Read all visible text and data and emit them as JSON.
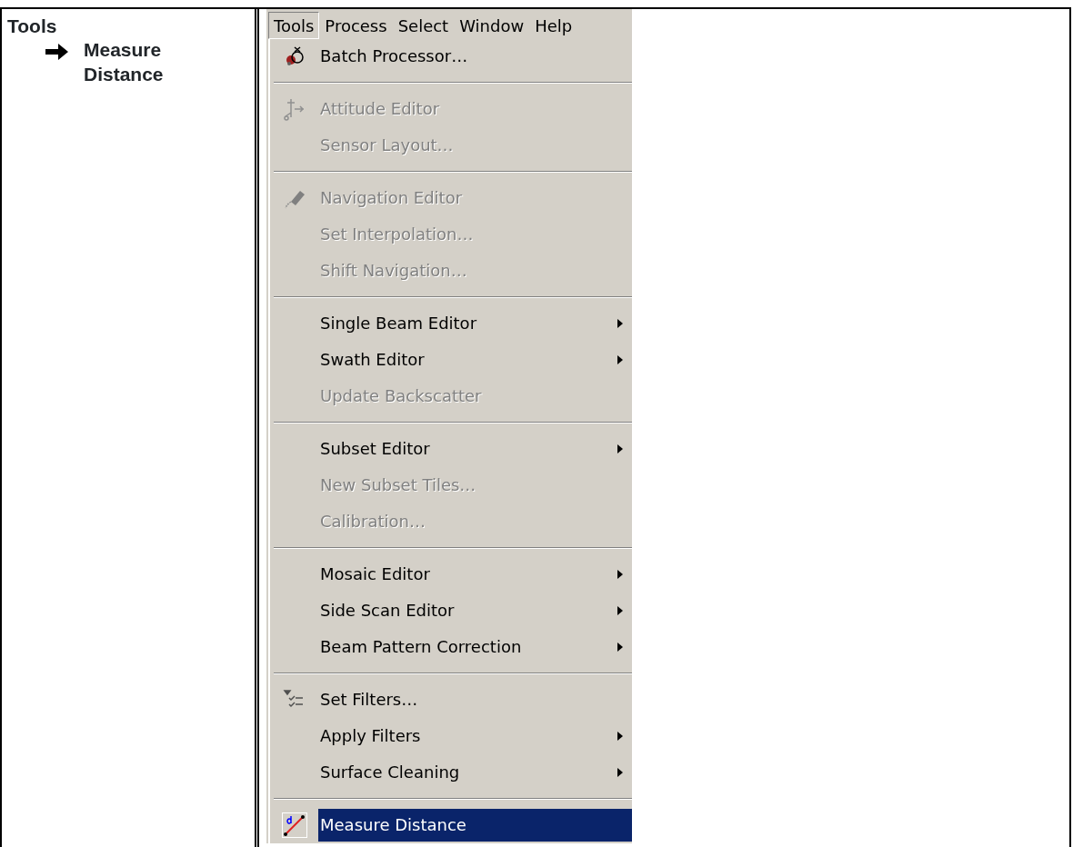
{
  "document_cell": {
    "heading": "Tools",
    "step": "Measure Distance"
  },
  "menubar": [
    {
      "label": "Tools",
      "selected": true
    },
    {
      "label": "Process",
      "selected": false
    },
    {
      "label": "Select",
      "selected": false
    },
    {
      "label": "Window",
      "selected": false
    },
    {
      "label": "Help",
      "selected": false
    }
  ],
  "menu_groups": [
    [
      {
        "label": "Batch Processor…",
        "disabled": false,
        "submenu": false,
        "selected": false
      }
    ],
    [
      {
        "label": "Attitude Editor",
        "disabled": true,
        "submenu": false,
        "selected": false
      },
      {
        "label": "Sensor Layout…",
        "disabled": true,
        "submenu": false,
        "selected": false
      }
    ],
    [
      {
        "label": "Navigation Editor",
        "disabled": true,
        "submenu": false,
        "selected": false
      },
      {
        "label": "Set Interpolation…",
        "disabled": true,
        "submenu": false,
        "selected": false
      },
      {
        "label": "Shift Navigation…",
        "disabled": true,
        "submenu": false,
        "selected": false
      }
    ],
    [
      {
        "label": "Single Beam Editor",
        "disabled": false,
        "submenu": true,
        "selected": false
      },
      {
        "label": "Swath Editor",
        "disabled": false,
        "submenu": true,
        "selected": false
      },
      {
        "label": "Update Backscatter",
        "disabled": true,
        "submenu": false,
        "selected": false
      }
    ],
    [
      {
        "label": "Subset Editor",
        "disabled": false,
        "submenu": true,
        "selected": false
      },
      {
        "label": "New Subset Tiles…",
        "disabled": true,
        "submenu": false,
        "selected": false
      },
      {
        "label": "Calibration…",
        "disabled": true,
        "submenu": false,
        "selected": false
      }
    ],
    [
      {
        "label": "Mosaic Editor",
        "disabled": false,
        "submenu": true,
        "selected": false
      },
      {
        "label": "Side Scan Editor",
        "disabled": false,
        "submenu": true,
        "selected": false
      },
      {
        "label": "Beam Pattern Correction",
        "disabled": false,
        "submenu": true,
        "selected": false
      }
    ],
    [
      {
        "label": "Set Filters…",
        "disabled": false,
        "submenu": false,
        "selected": false
      },
      {
        "label": "Apply Filters",
        "disabled": false,
        "submenu": true,
        "selected": false
      },
      {
        "label": "Surface Cleaning",
        "disabled": false,
        "submenu": true,
        "selected": false
      }
    ],
    [
      {
        "label": "Measure Distance",
        "disabled": false,
        "submenu": false,
        "selected": true
      }
    ]
  ]
}
